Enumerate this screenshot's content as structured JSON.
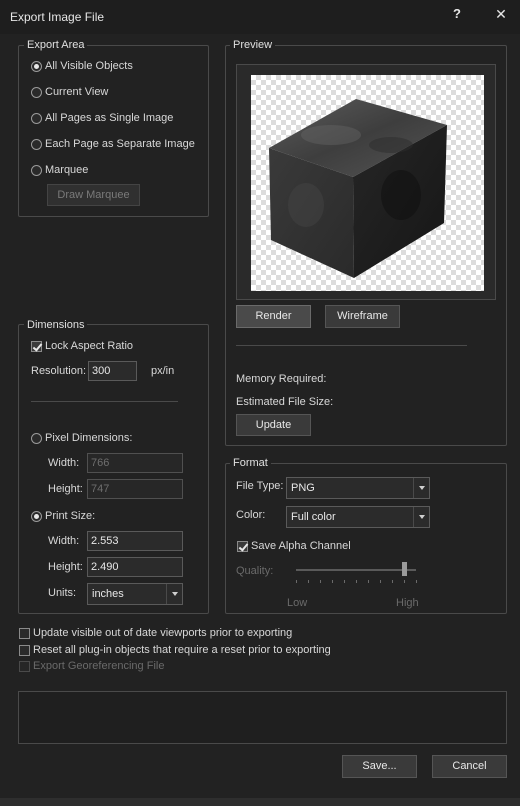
{
  "window": {
    "title": "Export Image File",
    "help": "?",
    "close": "✕"
  },
  "export_area": {
    "title": "Export Area",
    "options": [
      "All Visible Objects",
      "Current View",
      "All Pages as Single Image",
      "Each Page as Separate Image",
      "Marquee"
    ],
    "selected": "All Visible Objects",
    "draw_marquee": "Draw Marquee"
  },
  "preview": {
    "title": "Preview",
    "render": "Render",
    "wireframe": "Wireframe"
  },
  "dimensions": {
    "title": "Dimensions",
    "lock_aspect": "Lock Aspect Ratio",
    "resolution_label": "Resolution:",
    "resolution_value": "300",
    "resolution_unit": "px/in",
    "pixel_dimensions": "Pixel Dimensions:",
    "pixel_width_label": "Width:",
    "pixel_width_value": "766",
    "pixel_height_label": "Height:",
    "pixel_height_value": "747",
    "print_size": "Print Size:",
    "print_width_label": "Width:",
    "print_width_value": "2.553",
    "print_height_label": "Height:",
    "print_height_value": "2.490",
    "units_label": "Units:",
    "units_value": "inches"
  },
  "info": {
    "memory_required": "Memory Required:",
    "estimated_size": "Estimated File Size:",
    "update": "Update"
  },
  "format": {
    "title": "Format",
    "file_type_label": "File Type:",
    "file_type_value": "PNG",
    "color_label": "Color:",
    "color_value": "Full color",
    "save_alpha": "Save Alpha Channel",
    "quality_label": "Quality:",
    "quality_low": "Low",
    "quality_high": "High",
    "quality_level": 0.9
  },
  "options": {
    "update_viewports": "Update visible out of date viewports prior to exporting",
    "reset_plugins": "Reset all plug-in objects that require a reset prior to exporting",
    "export_georef": "Export Georeferencing File"
  },
  "actions": {
    "save": "Save...",
    "cancel": "Cancel"
  },
  "colors": {
    "background": "#222222",
    "border": "#4a4a4a",
    "text": "#d8d8d8"
  }
}
